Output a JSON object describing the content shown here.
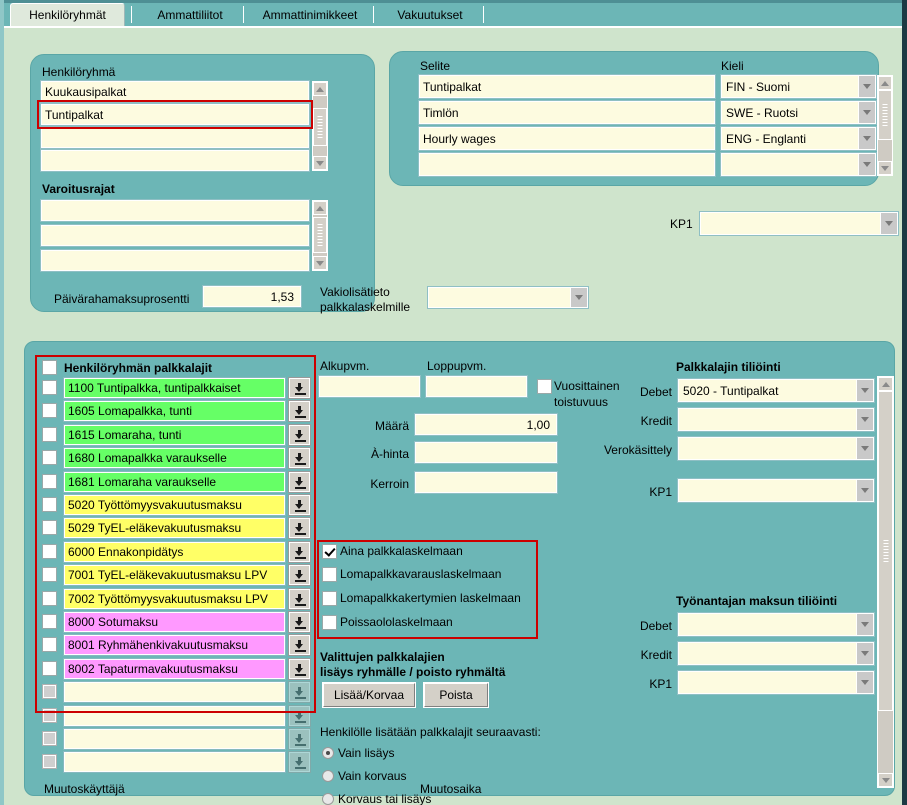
{
  "tabs": [
    {
      "label": "Henkilöryhmät",
      "active": true
    },
    {
      "label": "Ammattiliitot",
      "active": false
    },
    {
      "label": "Ammattinimikkeet",
      "active": false
    },
    {
      "label": "Vakuutukset",
      "active": false
    }
  ],
  "group_panel": {
    "label_henkiloryhma": "Henkilöryhmä",
    "henkiloryhma_items": [
      "Kuukausipalkat",
      "Tuntipalkat",
      "",
      ""
    ],
    "label_varoitusrajat": "Varoitusrajat",
    "varoitusrajat_items": [
      "",
      "",
      ""
    ],
    "paivaraha_label": "Päivärahamaksuprosentti",
    "paivaraha_value": "1,53",
    "vakiolisatieto_label_l1": "Vakiolisätieto",
    "vakiolisatieto_label_l2": "palkkalaskelmille",
    "vakiolisatieto_value": ""
  },
  "selite_panel": {
    "selite_label": "Selite",
    "kieli_label": "Kieli",
    "rows": [
      {
        "selite": "Tuntipalkat",
        "kieli": "FIN - Suomi"
      },
      {
        "selite": "Timlön",
        "kieli": "SWE - Ruotsi"
      },
      {
        "selite": "Hourly wages",
        "kieli": "ENG - Englanti"
      },
      {
        "selite": "",
        "kieli": ""
      }
    ],
    "kp1_label": "KP1",
    "kp1_value": ""
  },
  "palkkalajit": {
    "header_label": "Henkilöryhmän palkkalajit",
    "rows": [
      {
        "text": "1100 Tuntipalkka, tuntipalkkaiset",
        "color": "green"
      },
      {
        "text": "1605 Lomapalkka, tunti",
        "color": "green"
      },
      {
        "text": "1615 Lomaraha, tunti",
        "color": "green"
      },
      {
        "text": "1680 Lomapalkka varaukselle",
        "color": "green"
      },
      {
        "text": "1681 Lomaraha varaukselle",
        "color": "green"
      },
      {
        "text": "5020 Työttömyysvakuutusmaksu",
        "color": "yellow"
      },
      {
        "text": "5029 TyEL-eläkevakuutusmaksu",
        "color": "yellow"
      },
      {
        "text": "6000 Ennakonpidätys",
        "color": "yellow"
      },
      {
        "text": "7001 TyEL-eläkevakuutusmaksu LPV",
        "color": "yellow"
      },
      {
        "text": "7002 Työttömyysvakuutusmaksu LPV",
        "color": "yellow"
      },
      {
        "text": "8000 Sotumaksu",
        "color": "pink"
      },
      {
        "text": "8001 Ryhmähenkivakuutusmaksu",
        "color": "pink"
      },
      {
        "text": "8002 Tapaturmavakuutusmaksu",
        "color": "pink"
      },
      {
        "text": "",
        "color": "empty"
      },
      {
        "text": "",
        "color": "empty"
      },
      {
        "text": "",
        "color": "empty"
      },
      {
        "text": "",
        "color": "empty"
      }
    ],
    "footer_label": "Muutoskäyttäjä"
  },
  "detail": {
    "alkupvm_label": "Alkupvm.",
    "alkupvm_value": "",
    "loppupvm_label": "Loppupvm.",
    "loppupvm_value": "",
    "vuosittainen_label_l1": "Vuosittainen",
    "vuosittainen_label_l2": "toistuvuus",
    "vuosittainen_checked": false,
    "maara_label": "Määrä",
    "maara_value": "1,00",
    "ahinta_label": "À-hinta",
    "ahinta_value": "",
    "kerroin_label": "Kerroin",
    "kerroin_value": "",
    "checks": [
      {
        "label": "Aina palkkalaskelmaan",
        "checked": true
      },
      {
        "label": "Lomapalkkavarauslaskelmaan",
        "checked": false
      },
      {
        "label": "Lomapalkkakertymien laskelmaan",
        "checked": false
      },
      {
        "label": "Poissaololaskelmaan",
        "checked": false
      }
    ],
    "valittujen_label_l1": "Valittujen palkkalajien",
    "valittujen_label_l2": "lisäys ryhmälle / poisto ryhmältä",
    "btn_lisaa": "Lisää/Korvaa",
    "btn_poista": "Poista",
    "seuraavasti_label": "Henkilölle lisätään palkkalajit seuraavasti:",
    "radios": [
      {
        "label": "Vain lisäys",
        "selected": true
      },
      {
        "label": "Vain korvaus",
        "selected": false
      },
      {
        "label": "Korvaus tai lisäys",
        "selected": false
      }
    ],
    "muutosaika_label": "Muutosaika"
  },
  "tilioinnit": {
    "palkkalaji_title": "Palkkalajin tiliöinti",
    "debet_label": "Debet",
    "debet_value": "5020 - Tuntipalkat",
    "kredit_label": "Kredit",
    "kredit_value": "",
    "verokasittely_label": "Verokäsittely",
    "verokasittely_value": "",
    "kp1_label": "KP1",
    "kp1_value": "",
    "tyonantaja_title": "Työnantajan maksun tiliöinti",
    "ta_debet_label": "Debet",
    "ta_debet_value": "",
    "ta_kredit_label": "Kredit",
    "ta_kredit_value": "",
    "ta_kp1_label": "KP1",
    "ta_kp1_value": ""
  },
  "colors": {
    "panel_teal": "#6cb6b6",
    "page_green": "#cfe4cc",
    "field_cream": "#fdfbe0",
    "row_green": "#66ff66",
    "row_yellow": "#ffff66",
    "row_pink": "#ff99ff",
    "highlight_red": "#cc0000"
  }
}
